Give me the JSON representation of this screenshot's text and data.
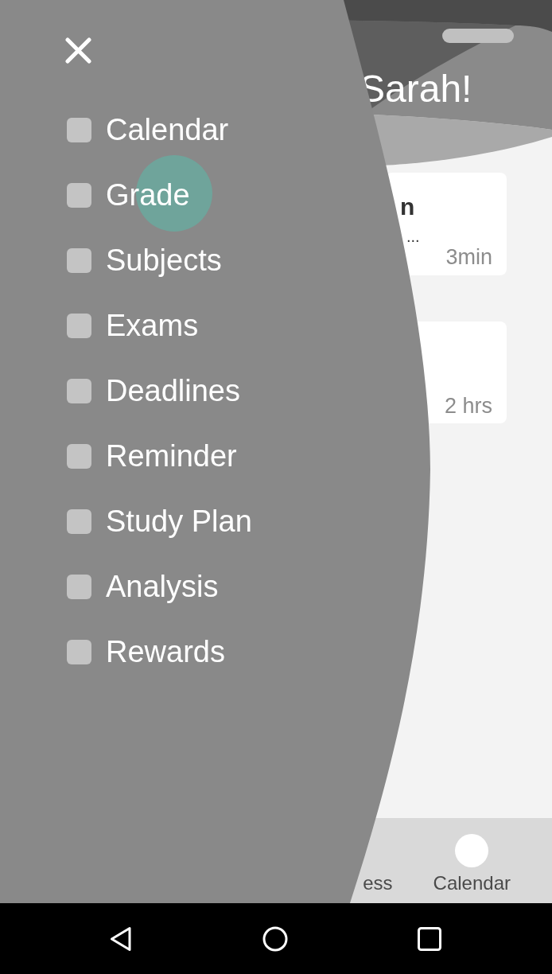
{
  "drawer": {
    "items": [
      {
        "label": "Calendar",
        "checked": false,
        "pressed": false
      },
      {
        "label": "Grade",
        "checked": false,
        "pressed": true
      },
      {
        "label": "Subjects",
        "checked": false,
        "pressed": false
      },
      {
        "label": "Exams",
        "checked": false,
        "pressed": false
      },
      {
        "label": "Deadlines",
        "checked": false,
        "pressed": false
      },
      {
        "label": "Reminder",
        "checked": false,
        "pressed": false
      },
      {
        "label": "Study Plan",
        "checked": false,
        "pressed": false
      },
      {
        "label": "Analysis",
        "checked": false,
        "pressed": false
      },
      {
        "label": "Rewards",
        "checked": false,
        "pressed": false
      }
    ]
  },
  "header": {
    "title": "Sarah!"
  },
  "cards": [
    {
      "title": "n",
      "subtitle": "...",
      "time": "3min"
    },
    {
      "time": "2 hrs"
    }
  ],
  "bottom_nav": {
    "items": [
      {
        "label": "ess"
      },
      {
        "label": "Calendar"
      }
    ]
  }
}
